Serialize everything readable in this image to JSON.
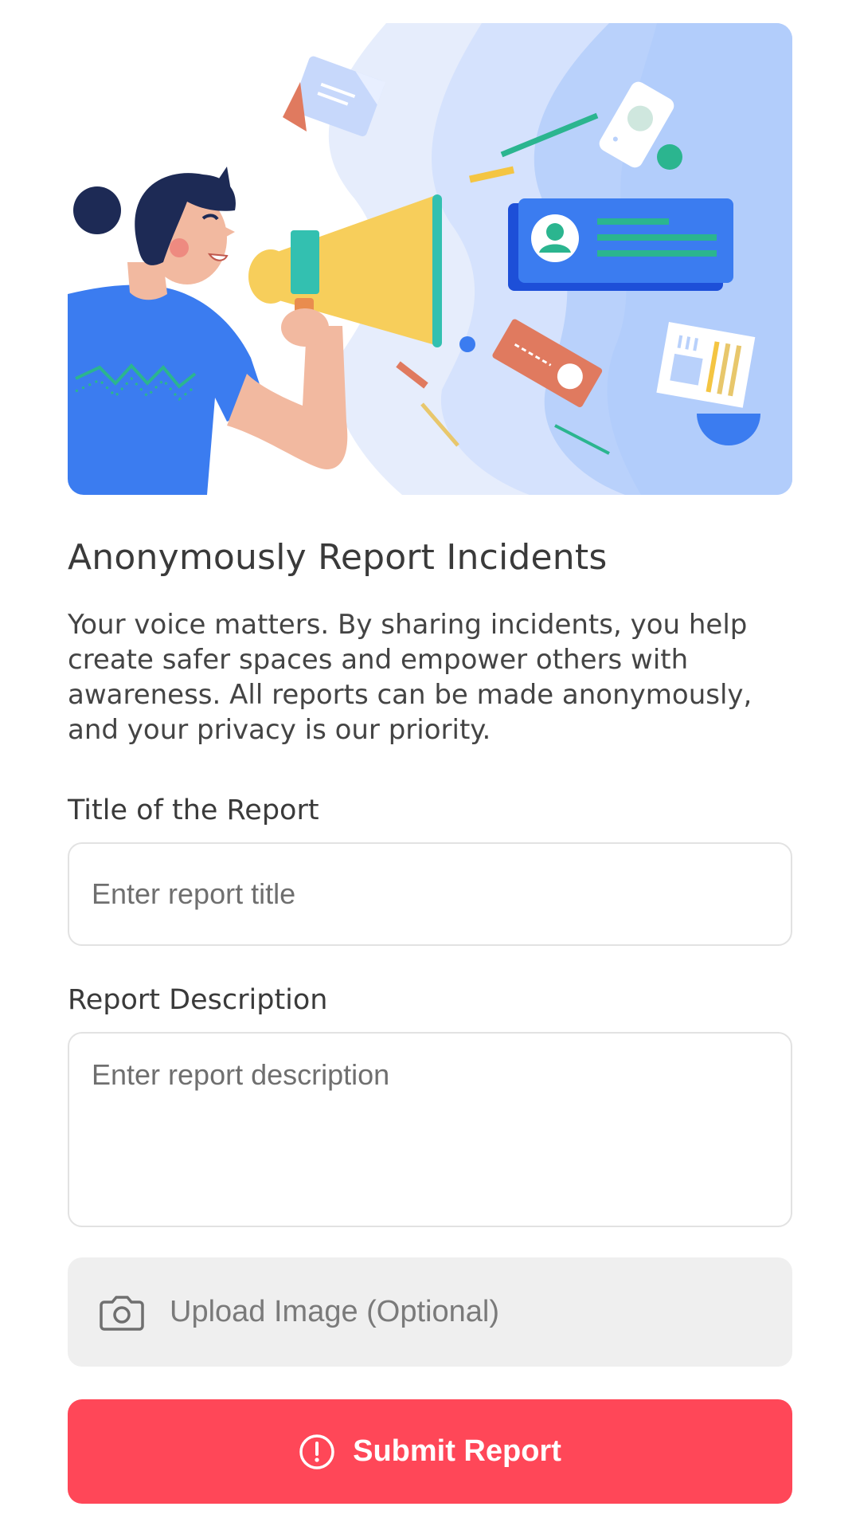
{
  "illustration": {
    "icon": "megaphone-announcement-illustration"
  },
  "content": {
    "heading": "Anonymously Report Incidents",
    "intro": "Your voice matters. By sharing incidents, you help create safer spaces and empower others with awareness. All reports can be made anonymously, and your privacy is our priority."
  },
  "form": {
    "title_label": "Title of the Report",
    "title_placeholder": "Enter report title",
    "title_value": "",
    "description_label": "Report Description",
    "description_placeholder": "Enter report description",
    "description_value": "",
    "upload_label": "Upload Image (Optional)",
    "upload_icon": "camera-icon",
    "submit_label": "Submit Report",
    "submit_icon": "alert-circle-icon"
  },
  "colors": {
    "accent": "#ff4758",
    "upload_background": "#efefef",
    "field_border": "#e2e2e2",
    "illustration_blue": "#3b7cf0",
    "illustration_light_blue": "#b9d1fb"
  }
}
